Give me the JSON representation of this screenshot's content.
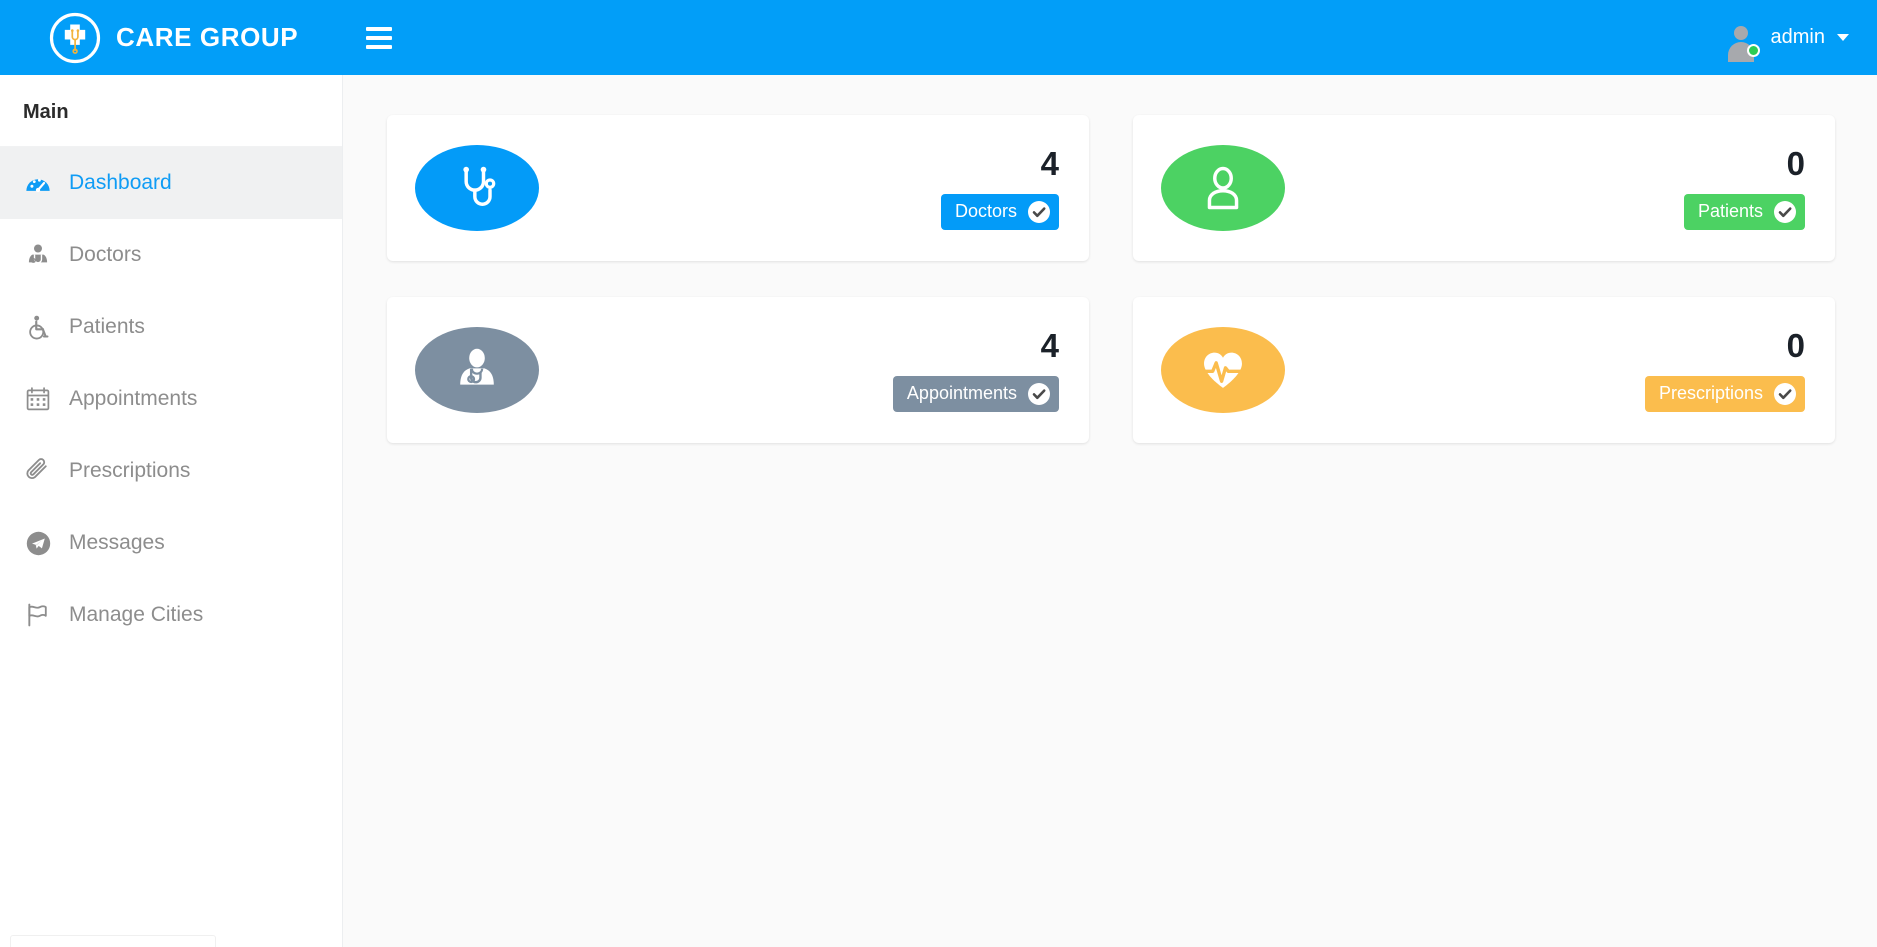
{
  "navbar": {
    "brand_title": "CARE GROUP",
    "logo_icon": "medical-cross-stethoscope-logo",
    "menu_toggle_icon": "hamburger-menu-icon",
    "user": {
      "name": "admin",
      "avatar_icon": "user-avatar-icon",
      "status": "online",
      "status_color": "#2ecc55",
      "caret_icon": "caret-down-icon"
    },
    "background_color": "#029ef8"
  },
  "sidebar": {
    "heading": "Main",
    "items": [
      {
        "label": "Dashboard",
        "icon": "tachometer-icon",
        "active": true
      },
      {
        "label": "Doctors",
        "icon": "user-md-icon",
        "active": false
      },
      {
        "label": "Patients",
        "icon": "wheelchair-icon",
        "active": false
      },
      {
        "label": "Appointments",
        "icon": "calendar-icon",
        "active": false
      },
      {
        "label": "Prescriptions",
        "icon": "paperclip-icon",
        "active": false
      },
      {
        "label": "Messages",
        "icon": "telegram-icon",
        "active": false
      },
      {
        "label": "Manage Cities",
        "icon": "flag-icon",
        "active": false
      }
    ],
    "active_color": "#0f9cf5",
    "inactive_color": "#8d8d8d"
  },
  "main": {
    "cards": [
      {
        "value": "4",
        "label": "Doctors",
        "icon": "stethoscope-icon",
        "color": "#039bf8",
        "check_icon": "check-circle-icon"
      },
      {
        "value": "0",
        "label": "Patients",
        "icon": "user-icon",
        "color": "#4cd263",
        "check_icon": "check-circle-icon"
      },
      {
        "value": "4",
        "label": "Appointments",
        "icon": "user-md-icon",
        "color": "#7d8fa1",
        "check_icon": "check-circle-icon"
      },
      {
        "value": "0",
        "label": "Prescriptions",
        "icon": "heartbeat-icon",
        "color": "#fbbd4d",
        "check_icon": "check-circle-icon"
      }
    ]
  }
}
